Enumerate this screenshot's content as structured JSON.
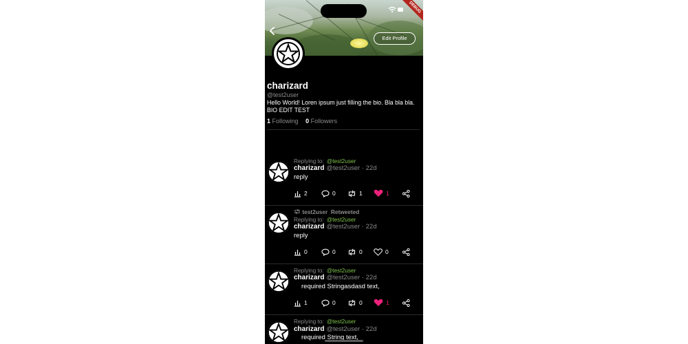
{
  "header": {
    "edit_profile_label": "Edit Profile",
    "debug_label": "DEBUG"
  },
  "profile": {
    "display_name": "charizard",
    "handle": "@test2user",
    "bio": "Hello World! Loren ipsum just filling the bio. Bla bla bla. BIO EDIT TEST",
    "following_count": "1",
    "following_label": "Following",
    "followers_count": "0",
    "followers_label": "Followers"
  },
  "tweets": [
    {
      "replying_label": "Replying to:",
      "replying_handle": "@test2user",
      "name": "charizard",
      "handle_time": "@test2user · 22d",
      "body": "reply",
      "views": "2",
      "comments": "0",
      "retweets": "1",
      "likes": "1",
      "liked": true
    },
    {
      "retweeted_by": "test2user",
      "retweeted_label": "Retweeted",
      "replying_label": "Replying to:",
      "replying_handle": "@test2user",
      "name": "charizard",
      "handle_time": "@test2user · 22d",
      "body": "reply",
      "views": "0",
      "comments": "0",
      "retweets": "0",
      "likes": "0",
      "liked": false
    },
    {
      "replying_label": "Replying to:",
      "replying_handle": "@test2user",
      "name": "charizard",
      "handle_time": "@test2user · 22d",
      "body": "required Stringasdasd text,",
      "views": "1",
      "comments": "0",
      "retweets": "0",
      "likes": "1",
      "liked": true
    },
    {
      "replying_label": "Replying to:",
      "replying_handle": "@test2user",
      "name": "charizard",
      "handle_time": "@test2user · 22d",
      "body": "required String text,"
    }
  ],
  "colors": {
    "accent_green": "#7fc24b",
    "like_pink": "#f0217a",
    "background": "#000000"
  }
}
